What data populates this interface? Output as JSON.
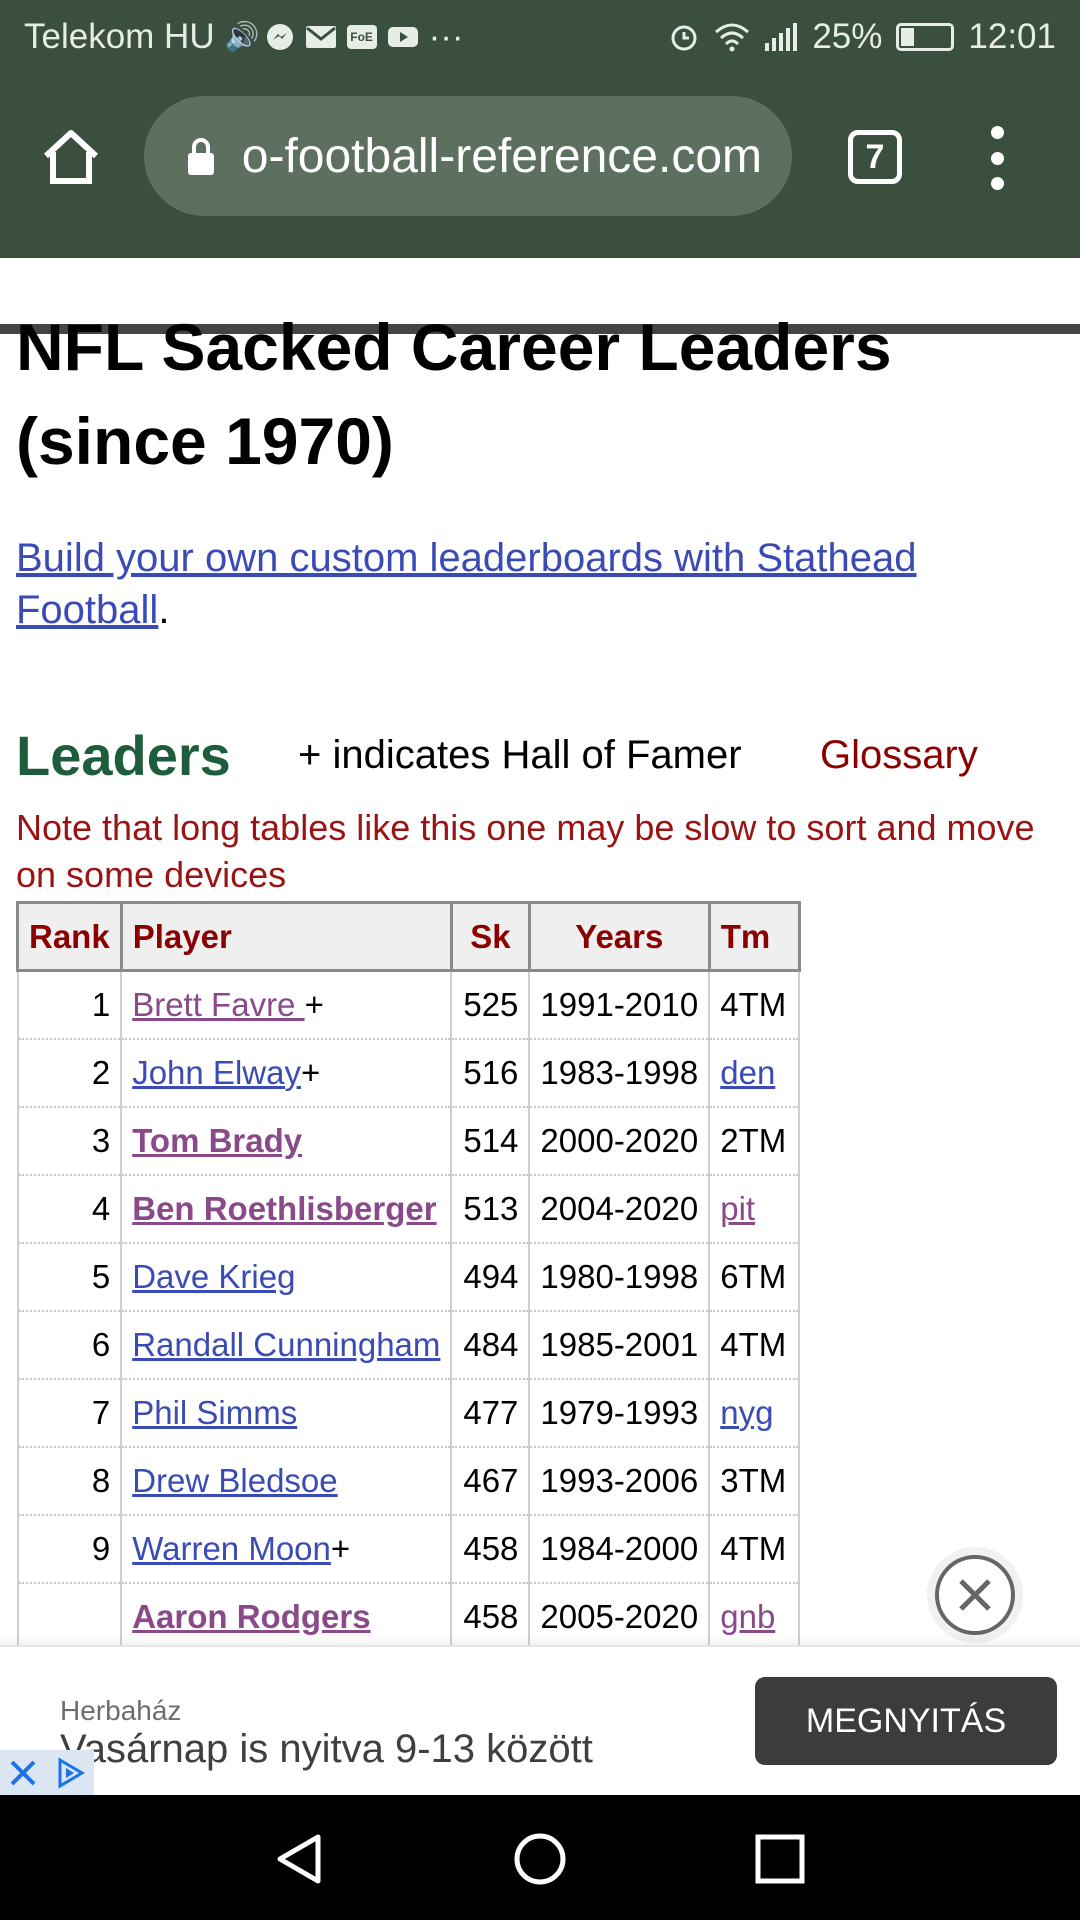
{
  "status_bar": {
    "carrier": "Telekom HU",
    "notification_icons": [
      "volume-icon",
      "messenger-icon",
      "mail-icon",
      "foe-icon",
      "youtube-icon",
      "more-icon"
    ],
    "more": "···",
    "foe": "FoE",
    "battery": "25%",
    "time": "12:01"
  },
  "browser": {
    "url": "pro-football-reference.com",
    "tab_count": "7"
  },
  "page": {
    "title_line1": "NFL Sacked Career Leaders",
    "title_line2": "(since 1970)",
    "promo_link_part1": "Build your own custom leaderboards with Stathead",
    "promo_link_part2": "Football",
    "promo_period": ".",
    "leaders_heading": "Leaders",
    "hof_note": "+ indicates Hall of Famer",
    "glossary": "Glossary",
    "note": "Note that long tables like this one may be slow to sort and move on some devices"
  },
  "table": {
    "headers": [
      "Rank",
      "Player",
      "Sk",
      "Years",
      "Tm"
    ],
    "rows": [
      {
        "rank": "1",
        "player": "Brett Favre ",
        "hof": "+",
        "sk": "525",
        "years": "1991-2010",
        "tm": "4TM"
      },
      {
        "rank": "2",
        "player": "John Elway",
        "hof": "+",
        "sk": "516",
        "years": "1983-1998",
        "tm": "den"
      },
      {
        "rank": "3",
        "player": "Tom Brady",
        "hof": "",
        "sk": "514",
        "years": "2000-2020",
        "tm": "2TM"
      },
      {
        "rank": "4",
        "player": "Ben Roethlisberger",
        "hof": "",
        "sk": "513",
        "years": "2004-2020",
        "tm": "pit"
      },
      {
        "rank": "5",
        "player": "Dave Krieg",
        "hof": "",
        "sk": "494",
        "years": "1980-1998",
        "tm": "6TM"
      },
      {
        "rank": "6",
        "player": "Randall Cunningham",
        "hof": "",
        "sk": "484",
        "years": "1985-2001",
        "tm": "4TM"
      },
      {
        "rank": "7",
        "player": "Phil Simms",
        "hof": "",
        "sk": "477",
        "years": "1979-1993",
        "tm": "nyg"
      },
      {
        "rank": "8",
        "player": "Drew Bledsoe",
        "hof": "",
        "sk": "467",
        "years": "1993-2006",
        "tm": "3TM"
      },
      {
        "rank": "9",
        "player": "Warren Moon",
        "hof": "+",
        "sk": "458",
        "years": "1984-2000",
        "tm": "4TM"
      },
      {
        "rank": "",
        "player": "Aaron Rodgers",
        "hof": "",
        "sk": "458",
        "years": "2005-2020",
        "tm": "gnb"
      }
    ]
  },
  "ad": {
    "brand": "Herbaház",
    "headline": "Vasárnap is nyitva 9-13 között",
    "cta": "MEGNYITÁS"
  },
  "colors": {
    "browser_bar": "#3b4f3e",
    "leaders_green": "#1d5d3d",
    "table_header_red": "#8b0000",
    "link_blue": "#3a4bb5",
    "visited_purple": "#8a4a8a"
  }
}
